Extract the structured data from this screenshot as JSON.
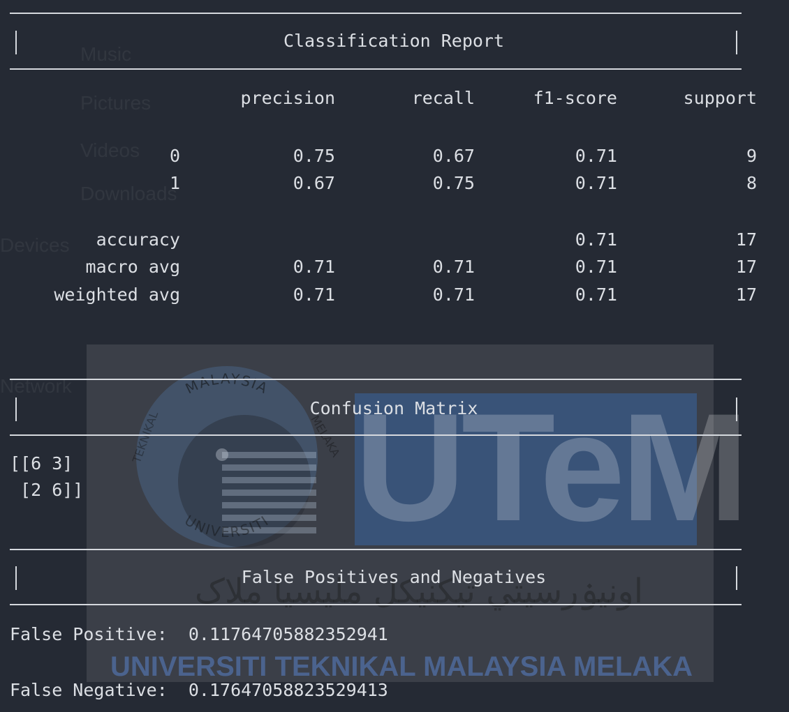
{
  "classification_report": {
    "title": "Classification Report",
    "headers": [
      "precision",
      "recall",
      "f1-score",
      "support"
    ],
    "rows": [
      {
        "label": "0",
        "precision": "0.75",
        "recall": "0.67",
        "f1": "0.71",
        "support": "9"
      },
      {
        "label": "1",
        "precision": "0.67",
        "recall": "0.75",
        "f1": "0.71",
        "support": "8"
      }
    ],
    "summary": [
      {
        "label": "accuracy",
        "precision": "",
        "recall": "",
        "f1": "0.71",
        "support": "17"
      },
      {
        "label": "macro avg",
        "precision": "0.71",
        "recall": "0.71",
        "f1": "0.71",
        "support": "17"
      },
      {
        "label": "weighted avg",
        "precision": "0.71",
        "recall": "0.71",
        "f1": "0.71",
        "support": "17"
      }
    ]
  },
  "confusion_matrix": {
    "title": "Confusion Matrix",
    "line1": "[[6 3]",
    "line2": " [2 6]]"
  },
  "false_rates": {
    "title": "False Positives and Negatives",
    "false_positive": "False Positive:  0.11764705882352941",
    "false_negative": "False Negative:  0.17647058823529413"
  },
  "watermark": {
    "brand": "UTeM",
    "university": "UNIVERSITI TEKNIKAL MALAYSIA MELAKA",
    "seal_top": "MALAYSIA",
    "seal_left": "TEKNIKAL",
    "seal_right": "MELAKA",
    "seal_bottom": "UNIVERSITI",
    "jawi": "اونيۏرسيتي تيکنيکل مليسيا ملاک"
  },
  "background": {
    "sidebar_items": [
      "Music",
      "Pictures",
      "Videos",
      "Downloads",
      "Devices",
      "Network"
    ]
  },
  "colors": {
    "background": "#252a34",
    "text": "#dcdfe4",
    "utem_blue": "#386cb4"
  }
}
